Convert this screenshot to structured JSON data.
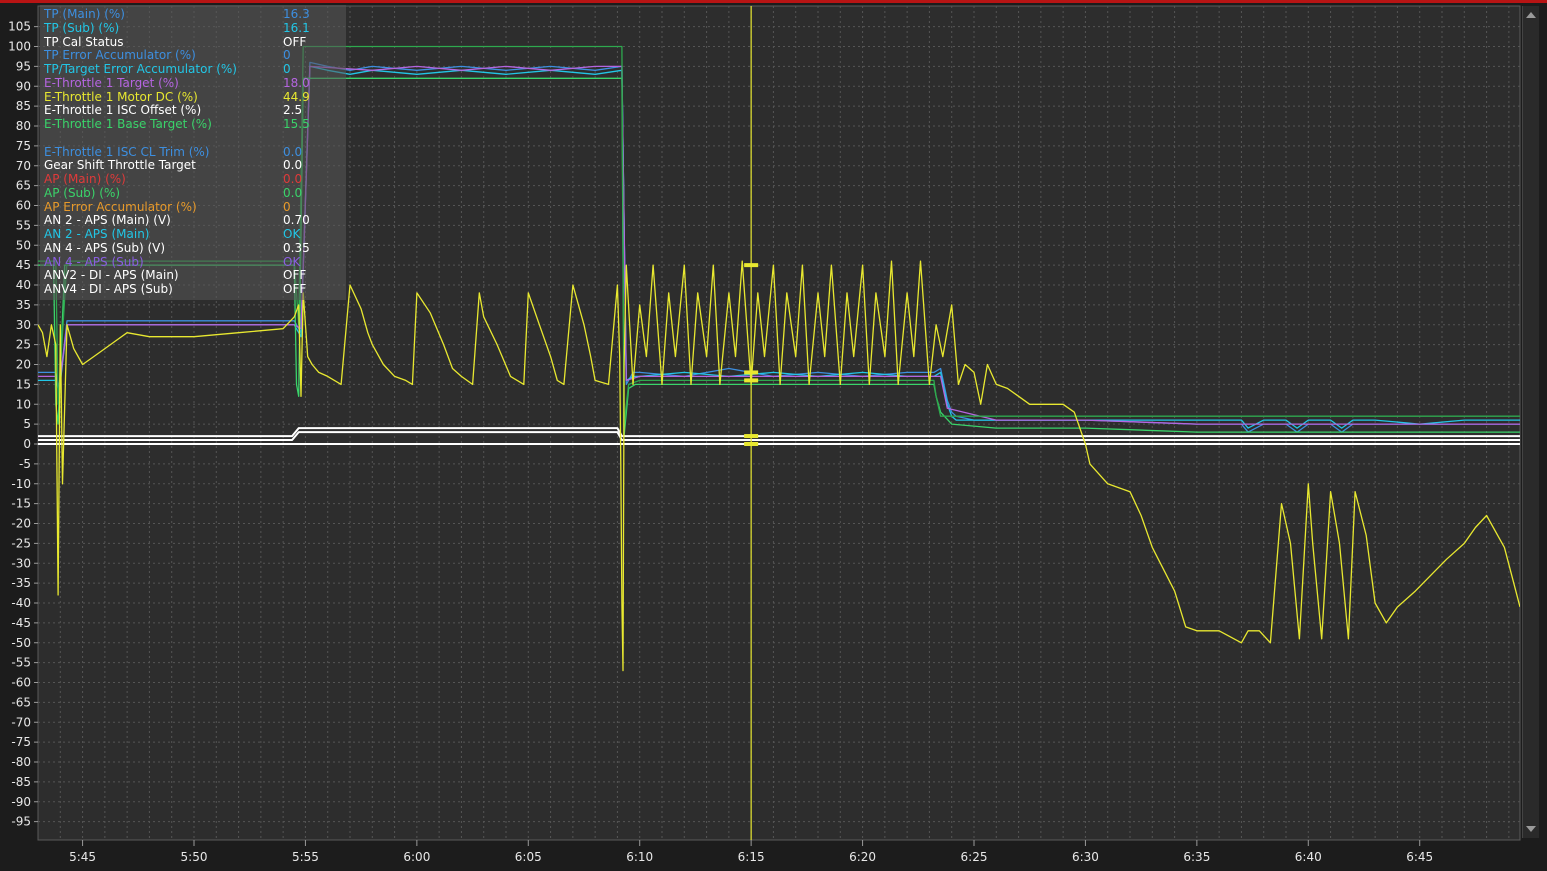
{
  "legend": [
    {
      "label": "TP (Main) (%)",
      "value": "16.3",
      "color": "#3d8fe0"
    },
    {
      "label": "TP (Sub) (%)",
      "value": "16.1",
      "color": "#22c6e6"
    },
    {
      "label": "TP Cal Status",
      "value": "OFF",
      "color": "#ffffff"
    },
    {
      "label": "TP Error Accumulator (%)",
      "value": "0",
      "color": "#3d8fe0"
    },
    {
      "label": "TP/Target Error Accumulator (%)",
      "value": "0",
      "color": "#22c6e6"
    },
    {
      "label": "E-Throttle 1 Target (%)",
      "value": "18.0",
      "color": "#b565e0"
    },
    {
      "label": "E-Throttle 1 Motor DC (%)",
      "value": "44.9",
      "color": "#e8e830"
    },
    {
      "label": "E-Throttle 1 ISC Offset (%)",
      "value": "2.5",
      "color": "#ffffff"
    },
    {
      "label": "E-Throttle 1 Base Target  (%)",
      "value": "15.5",
      "color": "#3ad36a"
    },
    {
      "label": "",
      "value": "",
      "color": "#2ea84e"
    },
    {
      "label": "E-Throttle 1 ISC CL Trim (%)",
      "value": "0.0",
      "color": "#3d8fe0"
    },
    {
      "label": "Gear Shift Throttle Target",
      "value": "0.0",
      "color": "#ffffff"
    },
    {
      "label": "AP (Main) (%)",
      "value": "0.0",
      "color": "#e03a3a"
    },
    {
      "label": "AP (Sub) (%)",
      "value": "0.0",
      "color": "#3ad36a"
    },
    {
      "label": "AP Error Accumulator (%)",
      "value": "0",
      "color": "#e89a2a"
    },
    {
      "label": "AN 2 - APS (Main) (V)",
      "value": "0.70",
      "color": "#ffffff"
    },
    {
      "label": "AN 2 - APS (Main)",
      "value": "OK",
      "color": "#22c6e6"
    },
    {
      "label": "AN 4 - APS (Sub) (V)",
      "value": "0.35",
      "color": "#ffffff"
    },
    {
      "label": "AN 4 - APS (Sub)",
      "value": "OK",
      "color": "#8a5ee0"
    },
    {
      "label": "ANV2 - DI - APS (Main)",
      "value": "OFF",
      "color": "#ffffff"
    },
    {
      "label": "ANV4 - DI - APS (Sub)",
      "value": "OFF",
      "color": "#ffffff"
    }
  ],
  "chart_data": {
    "type": "line",
    "x_unit": "minutes",
    "xlim": [
      343.0,
      409.5
    ],
    "ylim": [
      -100,
      108
    ],
    "grid": true,
    "ytick_labels": [
      "105",
      "100",
      "95",
      "90",
      "85",
      "80",
      "75",
      "70",
      "65",
      "60",
      "55",
      "50",
      "45",
      "40",
      "35",
      "30",
      "25",
      "20",
      "15",
      "10",
      "5",
      "0",
      "-5",
      "-10",
      "-15",
      "-20",
      "-25",
      "-30",
      "-35",
      "-40",
      "-45",
      "-50",
      "-55",
      "-60",
      "-65",
      "-70",
      "-75",
      "-80",
      "-85",
      "-90",
      "-95"
    ],
    "xtick_labels": [
      "5:45",
      "5:50",
      "5:55",
      "6:00",
      "6:05",
      "6:10",
      "6:15",
      "6:20",
      "6:25",
      "6:30",
      "6:35",
      "6:40",
      "6:45"
    ],
    "xtick_values": [
      345,
      350,
      355,
      360,
      365,
      370,
      375,
      380,
      385,
      390,
      395,
      400,
      405
    ],
    "cursor_x": 375.0,
    "series": [
      {
        "name": "TP (Main) (%)",
        "color": "#3d8fe0",
        "x": [
          343.0,
          343.8,
          343.95,
          344.3,
          354.5,
          354.8,
          354.9,
          355.2,
          356.0,
          357.0,
          358.0,
          360.0,
          362.0,
          364.0,
          366.0,
          368.0,
          369.2,
          369.4,
          369.7,
          370.0,
          372.0,
          374.0,
          376.0,
          378.0,
          380.0,
          382.0,
          383.2,
          383.5,
          383.8,
          384.0,
          384.2,
          385.0,
          386.0,
          390.0,
          395.0,
          397.0,
          397.3,
          398.0,
          399.0,
          399.5,
          400.0,
          401.0,
          401.5,
          402.0,
          403.0,
          405.0,
          407.0,
          409.5
        ],
        "y": [
          18,
          18,
          14,
          31,
          31,
          28,
          45,
          96,
          95,
          94,
          95,
          94,
          95,
          94,
          95,
          94,
          95,
          15,
          18,
          18,
          17,
          19,
          17,
          18,
          17,
          18,
          18,
          19,
          11,
          8,
          7,
          6,
          6,
          6,
          5,
          5,
          3,
          5,
          5,
          3,
          5,
          5,
          3,
          5,
          5,
          5,
          5,
          5
        ]
      },
      {
        "name": "TP (Sub) (%)",
        "color": "#22c6e6",
        "x": [
          343.0,
          343.8,
          343.95,
          344.3,
          354.5,
          354.8,
          354.9,
          355.2,
          356.0,
          357.0,
          358.0,
          360.0,
          362.0,
          364.0,
          366.0,
          368.0,
          369.2,
          369.4,
          369.7,
          370.0,
          372.0,
          374.0,
          376.0,
          378.0,
          380.0,
          382.0,
          383.2,
          383.5,
          383.8,
          384.0,
          384.2,
          385.0,
          386.0,
          390.0,
          395.0,
          397.0,
          397.3,
          398.0,
          399.0,
          399.5,
          400.0,
          401.0,
          401.5,
          402.0,
          403.0,
          405.0,
          407.0,
          409.5
        ],
        "y": [
          16,
          16,
          13,
          30,
          30,
          27,
          44,
          95,
          94,
          93,
          94,
          93,
          94,
          93,
          94,
          93,
          94,
          16,
          17,
          17,
          18,
          17,
          18,
          17,
          18,
          17,
          17,
          18,
          10,
          7,
          6,
          6,
          6,
          6,
          6,
          6,
          4,
          6,
          6,
          4,
          6,
          6,
          4,
          6,
          6,
          5,
          6,
          6
        ]
      },
      {
        "name": "E-Throttle 1 Target (%)",
        "color": "#b565e0",
        "x": [
          343.0,
          343.8,
          343.95,
          344.3,
          354.5,
          354.8,
          354.9,
          355.2,
          358.0,
          360.0,
          362.0,
          364.0,
          366.0,
          368.0,
          369.2,
          369.4,
          370.0,
          375.0,
          380.0,
          383.5,
          383.8,
          386.0,
          390.0,
          395.0,
          400.0,
          409.5
        ],
        "y": [
          17,
          17,
          14,
          30,
          30,
          29,
          44,
          95,
          94,
          95,
          94,
          95,
          94,
          95,
          95,
          16,
          17,
          17,
          17,
          17,
          9,
          6,
          6,
          5,
          5,
          5
        ]
      },
      {
        "name": "E-Throttle 1 Base Target  (%)",
        "color": "#3ad36a",
        "x": [
          343.0,
          343.7,
          343.8,
          343.9,
          344.2,
          354.5,
          354.6,
          354.7,
          354.9,
          369.2,
          369.3,
          369.5,
          369.8,
          383.2,
          383.3,
          383.5,
          384.0,
          386.0,
          390.0,
          395.0,
          397.0,
          409.5
        ],
        "y": [
          45,
          45,
          10,
          5,
          45,
          45,
          15,
          12,
          92,
          92,
          2,
          14,
          15,
          15,
          12,
          8,
          5,
          4,
          4,
          3,
          3,
          3
        ]
      },
      {
        "name": "AP (Sub) (%)",
        "color": "#2ea84e",
        "x": [
          343.0,
          343.8,
          343.9,
          344.3,
          354.5,
          354.7,
          354.9,
          369.2,
          369.3,
          369.5,
          370.0,
          383.2,
          383.3,
          383.5,
          409.5
        ],
        "y": [
          46,
          46,
          10,
          46,
          46,
          30,
          100,
          100,
          5,
          15,
          16,
          16,
          12,
          7,
          7
        ]
      },
      {
        "name": "E-Throttle 1 ISC Offset (%)",
        "color": "#ffffff",
        "x": [
          343.0,
          354.4,
          354.7,
          369.0,
          369.2,
          409.5
        ],
        "y": [
          2,
          2,
          4,
          4,
          2,
          2
        ]
      },
      {
        "name": "AN 2 - APS (Main) (V)",
        "color": "#ffffff",
        "x": [
          343.0,
          354.4,
          354.7,
          369.0,
          369.2,
          409.5
        ],
        "y": [
          1,
          1,
          3,
          3,
          1,
          1
        ]
      },
      {
        "name": "Gear Shift Throttle Target",
        "color": "#ffffff",
        "x": [
          343.0,
          409.5
        ],
        "y": [
          0,
          0
        ]
      },
      {
        "name": "E-Throttle 1 Motor DC (%)",
        "color": "#e8e830",
        "x": [
          343.0,
          343.2,
          343.4,
          343.6,
          343.8,
          343.9,
          344.0,
          344.1,
          344.3,
          344.6,
          345.0,
          345.5,
          346.0,
          346.5,
          347.0,
          348.0,
          350.0,
          352.0,
          354.0,
          354.5,
          354.7,
          354.8,
          354.9,
          355.1,
          355.3,
          355.6,
          356.0,
          356.3,
          356.6,
          357.0,
          357.5,
          357.8,
          358.0,
          358.5,
          359.0,
          359.5,
          359.8,
          360.0,
          360.6,
          361.2,
          361.6,
          362.0,
          362.5,
          362.8,
          363.0,
          363.6,
          364.2,
          364.8,
          365.0,
          365.5,
          366.0,
          366.3,
          366.6,
          367.0,
          367.5,
          367.8,
          368.0,
          368.6,
          369.0,
          369.1,
          369.15,
          369.2,
          369.25,
          369.3,
          369.4,
          369.7,
          370.0,
          370.3,
          370.6,
          371.0,
          371.3,
          371.6,
          372.0,
          372.3,
          372.6,
          373.0,
          373.3,
          373.6,
          374.0,
          374.3,
          374.6,
          375.0,
          375.3,
          375.6,
          376.0,
          376.3,
          376.6,
          377.0,
          377.3,
          377.6,
          378.0,
          378.3,
          378.6,
          379.0,
          379.3,
          379.6,
          380.0,
          380.3,
          380.6,
          381.0,
          381.3,
          381.6,
          382.0,
          382.3,
          382.6,
          383.0,
          383.3,
          383.6,
          384.0,
          384.3,
          384.6,
          385.0,
          385.3,
          385.6,
          386.0,
          386.5,
          387.0,
          387.5,
          388.0,
          389.0,
          389.5,
          390.0,
          390.2,
          391.0,
          392.0,
          392.5,
          393.0,
          394.0,
          394.5,
          395.0,
          396.0,
          397.0,
          397.3,
          397.8,
          398.3,
          398.8,
          399.2,
          399.6,
          400.0,
          400.2,
          400.6,
          401.0,
          401.4,
          401.8,
          402.1,
          402.6,
          403.0,
          403.5,
          404.0,
          404.8,
          405.5,
          406.2,
          407.0,
          407.5,
          408.0,
          408.8,
          409.5
        ],
        "y": [
          30,
          28,
          22,
          30,
          25,
          -38,
          30,
          -10,
          30,
          24,
          20,
          22,
          24,
          26,
          28,
          27,
          27,
          28,
          29,
          32,
          35,
          12,
          38,
          22,
          20,
          18,
          17,
          16,
          15,
          40,
          34,
          28,
          25,
          20,
          17,
          16,
          15,
          38,
          33,
          25,
          19,
          17,
          15,
          38,
          32,
          25,
          17,
          15,
          38,
          30,
          22,
          16,
          15,
          40,
          30,
          22,
          16,
          15,
          40,
          22,
          -5,
          -40,
          -57,
          20,
          45,
          15,
          35,
          22,
          45,
          15,
          38,
          22,
          45,
          15,
          38,
          22,
          45,
          15,
          38,
          22,
          46,
          15,
          38,
          22,
          45,
          15,
          38,
          22,
          45,
          15,
          38,
          22,
          45,
          15,
          38,
          22,
          45,
          15,
          38,
          22,
          46,
          15,
          38,
          22,
          46,
          15,
          30,
          22,
          35,
          15,
          20,
          18,
          10,
          20,
          15,
          14,
          12,
          10,
          10,
          10,
          8,
          0,
          -5,
          -10,
          -12,
          -18,
          -26,
          -37,
          -46,
          -47,
          -47,
          -50,
          -47,
          -47,
          -50,
          -15,
          -25,
          -49,
          -10,
          -25,
          -49,
          -12,
          -25,
          -49,
          -12,
          -23,
          -40,
          -45,
          -41,
          -37,
          -33,
          -29,
          -25,
          -21,
          -18,
          -26,
          -41
        ]
      }
    ]
  }
}
